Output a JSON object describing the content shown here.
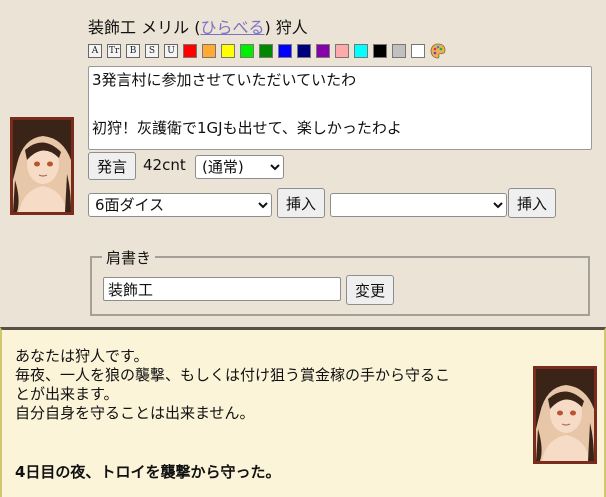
{
  "speaker": {
    "title_label": "装飾工 メリル",
    "handle": "ひらべる",
    "role_label": "狩人"
  },
  "toolbar": {
    "format_buttons": [
      {
        "name": "large-text-icon",
        "glyph": "A"
      },
      {
        "name": "small-text-icon",
        "glyph": "Tr"
      },
      {
        "name": "bold-icon",
        "glyph": "B"
      },
      {
        "name": "strikethrough-icon",
        "glyph": "S"
      },
      {
        "name": "underline-icon",
        "glyph": "U"
      }
    ],
    "colors": [
      "#ff0000",
      "#ffaa33",
      "#ffff00",
      "#00ee00",
      "#008800",
      "#0000ff",
      "#00007f",
      "#8800aa",
      "#ffaaaa",
      "#00ffff",
      "#000000",
      "#c0c0c0",
      "#ffffff"
    ],
    "palette_icon": "palette-icon"
  },
  "message": {
    "text": "3発言村に参加させていただいていたわ\n\n初狩！灰護衛で1GJも出せて、楽しかったわよ"
  },
  "controls": {
    "speak_label": "発言",
    "char_count": "42cnt",
    "mode_selected": "(通常)",
    "dice_selected": "6面ダイス",
    "insert_label": "挿入",
    "second_select_selected": "",
    "insert_label_2": "挿入"
  },
  "shoulder": {
    "legend": "肩書き",
    "value": "装飾工",
    "change_label": "変更"
  },
  "role_info": {
    "lines": [
      "あなたは狩人です。",
      "毎夜、一人を狼の襲撃、もしくは付け狙う賞金稼の手から守るこ",
      "とが出来ます。",
      "自分自身を守ることは出来ません。"
    ],
    "result": "4日目の夜、トロイを襲撃から守った。"
  }
}
